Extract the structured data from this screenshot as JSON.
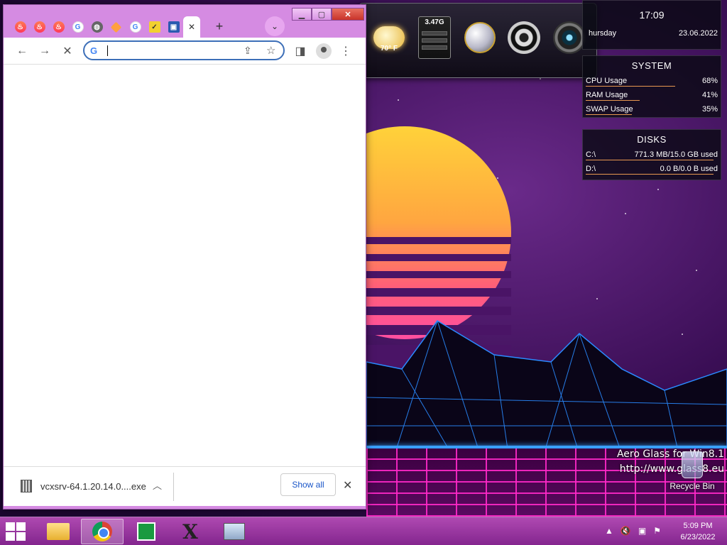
{
  "browser": {
    "tabs": [
      {
        "icon": "tinder-icon",
        "active": false
      },
      {
        "icon": "tinder-icon",
        "active": false
      },
      {
        "icon": "tinder-icon",
        "active": false
      },
      {
        "icon": "google-icon",
        "active": false
      },
      {
        "icon": "globe-icon",
        "active": false
      },
      {
        "icon": "diamond-icon",
        "active": false
      },
      {
        "icon": "google-icon",
        "active": false
      },
      {
        "icon": "checkmark-icon",
        "active": false
      },
      {
        "icon": "blue-app-icon",
        "active": false
      },
      {
        "icon": "close-icon",
        "active": true
      }
    ],
    "omnibox": {
      "value": "",
      "placeholder": ""
    },
    "downloads": {
      "filename": "vcxsrv-64.1.20.14.0....exe",
      "show_all_label": "Show all"
    }
  },
  "dock": {
    "weather_temp": "70° F",
    "memory_label": "3.47G"
  },
  "clock_gadget": {
    "time": "17:09",
    "day": "hursday",
    "date": "23.06.2022"
  },
  "system_gadget": {
    "title": "SYSTEM",
    "rows": [
      {
        "label": "CPU Usage",
        "value": "68%",
        "fraction": 0.68
      },
      {
        "label": "RAM Usage",
        "value": "41%",
        "fraction": 0.41
      },
      {
        "label": "SWAP Usage",
        "value": "35%",
        "fraction": 0.35
      }
    ]
  },
  "disks_gadget": {
    "title": "DISKS",
    "rows": [
      {
        "label": "C:\\",
        "value": "771.3 MB/15.0 GB used",
        "fraction": 0.05
      },
      {
        "label": "D:\\",
        "value": "0.0 B/0.0 B used",
        "fraction": 0.0
      }
    ]
  },
  "desktop": {
    "watermark_line1": "Aero Glass for Win8.1",
    "watermark_line2": "http://www.glass8.eu",
    "recycle_bin_label": "Recycle Bin"
  },
  "taskbar": {
    "time": "5:09 PM",
    "date": "6/23/2022",
    "accent": "#c050c0"
  }
}
